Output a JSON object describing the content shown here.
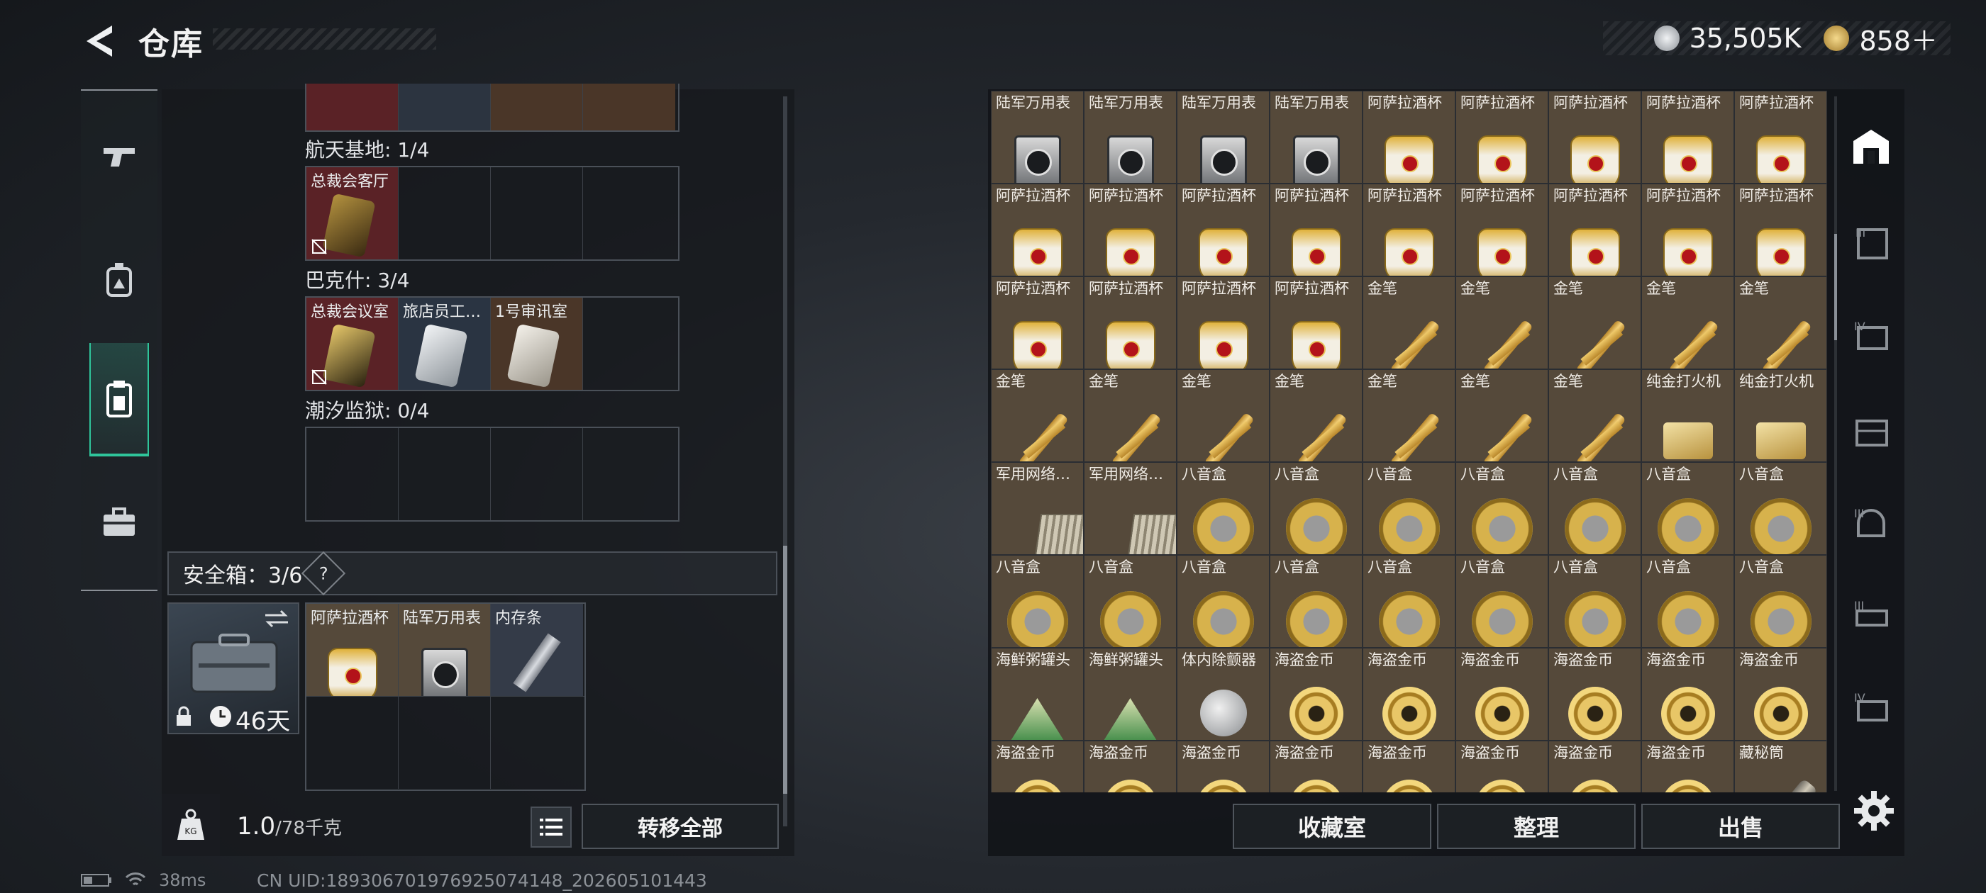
{
  "header": {
    "title": "仓库"
  },
  "currency": [
    {
      "name": "hafu-coin-icon",
      "value": "35,505K",
      "color": "#c9cdd2"
    },
    {
      "name": "triangle-coin-icon",
      "value": "858＋",
      "color": "#d8a94a"
    }
  ],
  "left": {
    "sections": [
      {
        "label": "航天基地: 1/4",
        "cells": [
          {
            "name": "总裁会客厅",
            "card": "#b4923f",
            "no": true
          },
          {
            "name": ""
          },
          {
            "name": ""
          },
          {
            "name": ""
          }
        ]
      },
      {
        "label": "巴克什: 3/4",
        "cells": [
          {
            "name": "总裁会议室",
            "card": "#c9a44a",
            "no": true
          },
          {
            "name": "旅店员工…",
            "card": "#d8dde2"
          },
          {
            "name": "1号审讯室",
            "card": "#e4e0d8"
          },
          {
            "name": ""
          }
        ]
      },
      {
        "label": "潮汐监狱: 0/4",
        "cells": [
          {
            "name": ""
          },
          {
            "name": ""
          },
          {
            "name": ""
          },
          {
            "name": ""
          }
        ]
      }
    ],
    "safe": {
      "title": "安全箱：3/6",
      "help": "?",
      "days": "46天",
      "items": [
        "阿萨拉酒杯",
        "陆军万用表",
        "内存条"
      ]
    },
    "weight": {
      "current": "1.0",
      "max": "/78千克",
      "unit_icon": "KG"
    },
    "transfer_all": "转移全部"
  },
  "grid": {
    "rows": [
      [
        [
          "陆军万用表",
          "watch"
        ],
        [
          "陆军万用表",
          "watch"
        ],
        [
          "陆军万用表",
          "watch"
        ],
        [
          "陆军万用表",
          "watch"
        ],
        [
          "阿萨拉酒杯",
          "cup"
        ],
        [
          "阿萨拉酒杯",
          "cup"
        ],
        [
          "阿萨拉酒杯",
          "cup"
        ],
        [
          "阿萨拉酒杯",
          "cup"
        ],
        [
          "阿萨拉酒杯",
          "cup"
        ]
      ],
      [
        [
          "阿萨拉酒杯",
          "cup"
        ],
        [
          "阿萨拉酒杯",
          "cup"
        ],
        [
          "阿萨拉酒杯",
          "cup"
        ],
        [
          "阿萨拉酒杯",
          "cup"
        ],
        [
          "阿萨拉酒杯",
          "cup"
        ],
        [
          "阿萨拉酒杯",
          "cup"
        ],
        [
          "阿萨拉酒杯",
          "cup"
        ],
        [
          "阿萨拉酒杯",
          "cup"
        ],
        [
          "阿萨拉酒杯",
          "cup"
        ]
      ],
      [
        [
          "阿萨拉酒杯",
          "cup"
        ],
        [
          "阿萨拉酒杯",
          "cup"
        ],
        [
          "阿萨拉酒杯",
          "cup"
        ],
        [
          "阿萨拉酒杯",
          "cup"
        ],
        [
          "金笔",
          "pen"
        ],
        [
          "金笔",
          "pen"
        ],
        [
          "金笔",
          "pen"
        ],
        [
          "金笔",
          "pen"
        ],
        [
          "金笔",
          "pen"
        ]
      ],
      [
        [
          "金笔",
          "pen"
        ],
        [
          "金笔",
          "pen"
        ],
        [
          "金笔",
          "pen"
        ],
        [
          "金笔",
          "pen"
        ],
        [
          "金笔",
          "pen"
        ],
        [
          "金笔",
          "pen"
        ],
        [
          "金笔",
          "pen"
        ],
        [
          "纯金打火机",
          "lighter"
        ],
        [
          "纯金打火机",
          "lighter"
        ]
      ],
      [
        [
          "军用网络…",
          "netbox"
        ],
        [
          "军用网络…",
          "netbox"
        ],
        [
          "八音盒",
          "musicbox"
        ],
        [
          "八音盒",
          "musicbox"
        ],
        [
          "八音盒",
          "musicbox"
        ],
        [
          "八音盒",
          "musicbox"
        ],
        [
          "八音盒",
          "musicbox"
        ],
        [
          "八音盒",
          "musicbox"
        ],
        [
          "八音盒",
          "musicbox"
        ]
      ],
      [
        [
          "八音盒",
          "musicbox"
        ],
        [
          "八音盒",
          "musicbox"
        ],
        [
          "八音盒",
          "musicbox"
        ],
        [
          "八音盒",
          "musicbox"
        ],
        [
          "八音盒",
          "musicbox"
        ],
        [
          "八音盒",
          "musicbox"
        ],
        [
          "八音盒",
          "musicbox"
        ],
        [
          "八音盒",
          "musicbox"
        ],
        [
          "八音盒",
          "musicbox"
        ]
      ],
      [
        [
          "海鲜粥罐头",
          "can"
        ],
        [
          "海鲜粥罐头",
          "can"
        ],
        [
          "体内除颤器",
          "pendant"
        ],
        [
          "海盗金币",
          "coinitem"
        ],
        [
          "海盗金币",
          "coinitem"
        ],
        [
          "海盗金币",
          "coinitem"
        ],
        [
          "海盗金币",
          "coinitem"
        ],
        [
          "海盗金币",
          "coinitem"
        ],
        [
          "海盗金币",
          "coinitem"
        ]
      ],
      [
        [
          "海盗金币",
          "coinitem"
        ],
        [
          "海盗金币",
          "coinitem"
        ],
        [
          "海盗金币",
          "coinitem"
        ],
        [
          "海盗金币",
          "coinitem"
        ],
        [
          "海盗金币",
          "coinitem"
        ],
        [
          "海盗金币",
          "coinitem"
        ],
        [
          "海盗金币",
          "coinitem"
        ],
        [
          "海盗金币",
          "coinitem"
        ],
        [
          "藏秘筒",
          "tube"
        ]
      ]
    ]
  },
  "buttons": {
    "collection": "收藏室",
    "organize": "整理",
    "sell": "出售"
  },
  "status": {
    "ping": "38ms",
    "uid": "CN UID:18930670197692507414​8_202605101443"
  }
}
